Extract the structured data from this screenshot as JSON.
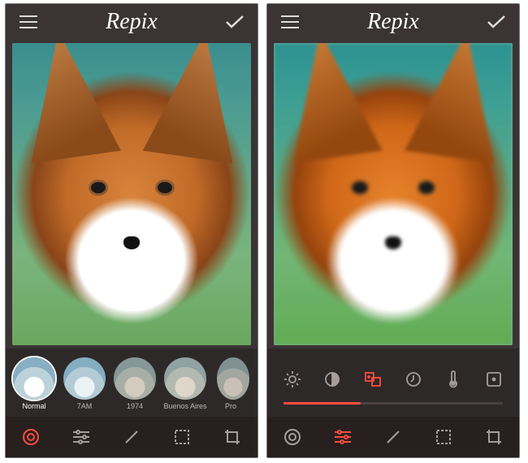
{
  "app_title": "Repix",
  "accent_color": "#ff4b3e",
  "left": {
    "filters": [
      {
        "id": "normal",
        "label": "Normal",
        "selected": true
      },
      {
        "id": "7am",
        "label": "7AM",
        "selected": false
      },
      {
        "id": "1974",
        "label": "1974",
        "selected": false
      },
      {
        "id": "buenos-aires",
        "label": "Buenos Aires",
        "selected": false
      },
      {
        "id": "pro",
        "label": "Pro",
        "selected": false
      }
    ],
    "bottom_active": "effects"
  },
  "right": {
    "adjust_tools": [
      {
        "id": "brightness",
        "name": "brightness-icon",
        "selected": false
      },
      {
        "id": "contrast",
        "name": "contrast-icon",
        "selected": false
      },
      {
        "id": "sharpen",
        "name": "sharpen-icon",
        "selected": true
      },
      {
        "id": "saturation",
        "name": "saturation-icon",
        "selected": false
      },
      {
        "id": "temperature",
        "name": "temperature-icon",
        "selected": false
      },
      {
        "id": "vignette",
        "name": "vignette-icon",
        "selected": false
      }
    ],
    "slider_value_pct": 35,
    "bottom_active": "adjust"
  },
  "bottom_tools": [
    {
      "id": "effects",
      "name": "effects-icon"
    },
    {
      "id": "adjust",
      "name": "adjust-icon"
    },
    {
      "id": "brush",
      "name": "brush-icon"
    },
    {
      "id": "frames",
      "name": "frames-icon"
    },
    {
      "id": "crop",
      "name": "crop-icon"
    }
  ]
}
